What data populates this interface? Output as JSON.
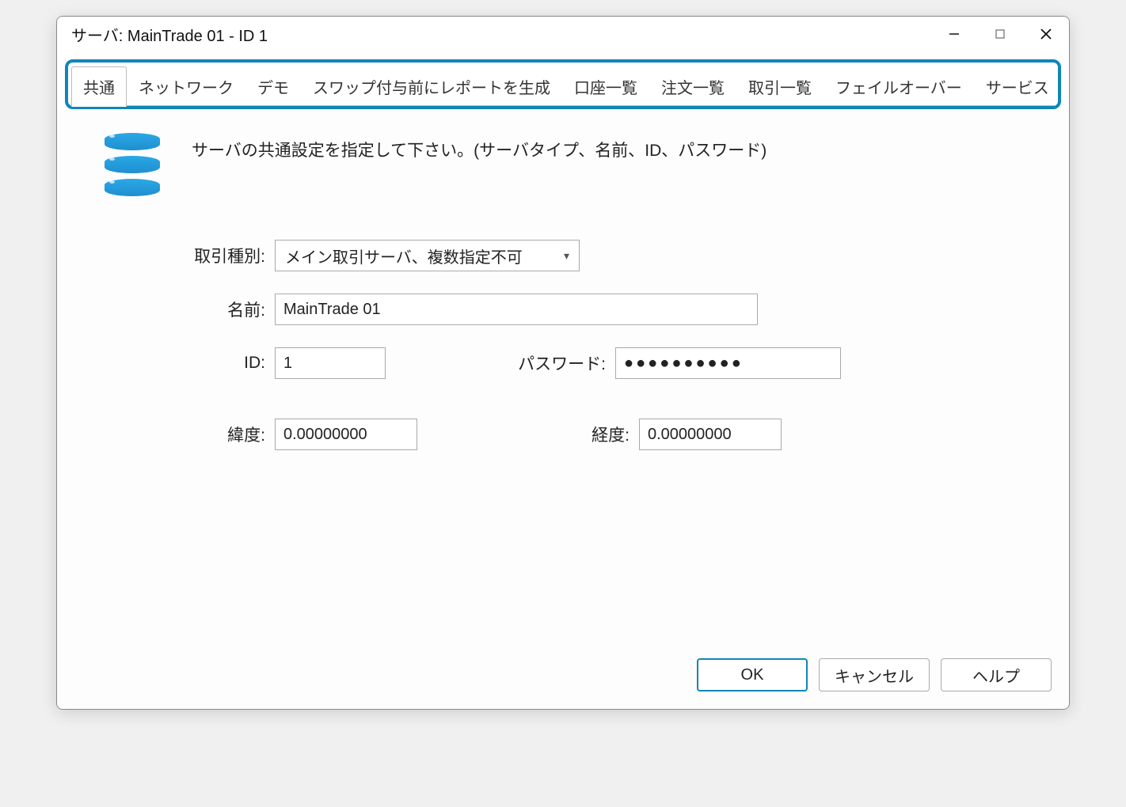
{
  "window": {
    "title": "サーバ: MainTrade 01 - ID  1"
  },
  "tabs": {
    "items": [
      "共通",
      "ネットワーク",
      "デモ",
      "スワップ付与前にレポートを生成",
      "口座一覧",
      "注文一覧",
      "取引一覧",
      "フェイルオーバー",
      "サービス"
    ],
    "active_index": 0
  },
  "description": "サーバの共通設定を指定して下さい。(サーバタイプ、名前、ID、パスワード)",
  "form": {
    "trade_type": {
      "label": "取引種別:",
      "value": "メイン取引サーバ、複数指定不可"
    },
    "name": {
      "label": "名前:",
      "value": "MainTrade 01"
    },
    "id": {
      "label": "ID:",
      "value": "1"
    },
    "password": {
      "label": "パスワード:",
      "value": "●●●●●●●●●●"
    },
    "latitude": {
      "label": "緯度:",
      "value": "0.00000000"
    },
    "longitude": {
      "label": "経度:",
      "value": "0.00000000"
    }
  },
  "buttons": {
    "ok": "OK",
    "cancel": "キャンセル",
    "help": "ヘルプ"
  }
}
